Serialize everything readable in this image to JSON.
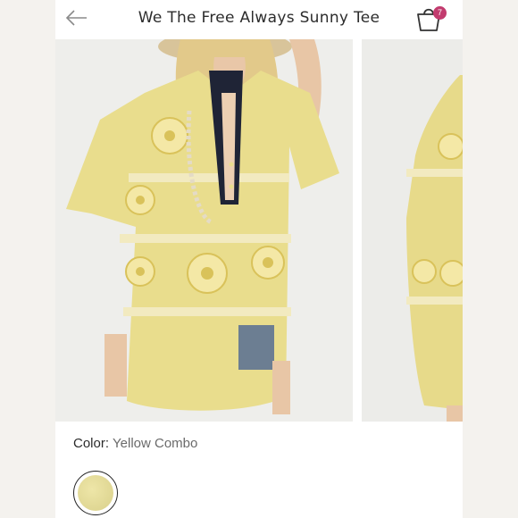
{
  "header": {
    "title": "We The Free Always Sunny Tee",
    "back_icon": "arrow-left-icon",
    "bag_icon": "shopping-bag-icon",
    "bag_count": "7"
  },
  "gallery": {
    "images": [
      "product-photo-front",
      "product-photo-side"
    ]
  },
  "color": {
    "label": "Color:",
    "value": "Yellow Combo"
  },
  "swatches": [
    {
      "name": "Yellow Combo",
      "selected": true,
      "hex": "#e4dc9a"
    }
  ],
  "colors": {
    "accent": "#c23b6e",
    "fabric": "#e8dc8e"
  }
}
